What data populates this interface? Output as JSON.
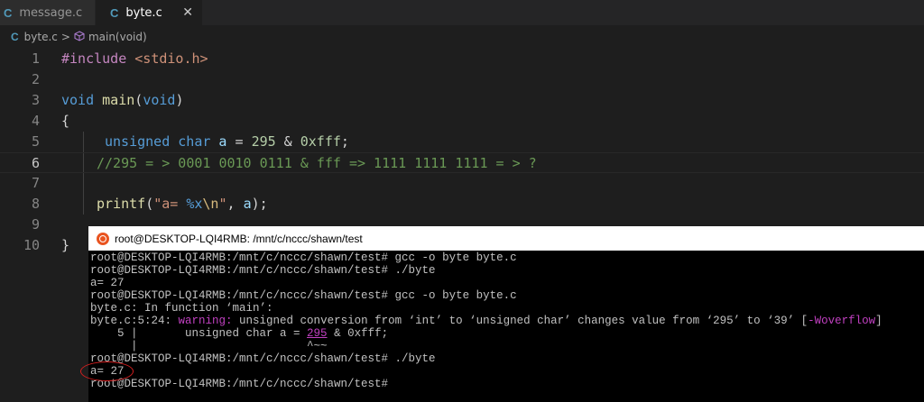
{
  "tabs": [
    {
      "icon": "C",
      "label": "message.c",
      "active": false
    },
    {
      "icon": "C",
      "label": "byte.c",
      "active": true,
      "close": "✕"
    }
  ],
  "breadcrumb": {
    "file": "byte.c",
    "separator": ">",
    "symbol": "main(void)"
  },
  "editor": {
    "line_numbers": [
      "1",
      "2",
      "3",
      "4",
      "5",
      "6",
      "7",
      "8",
      "9",
      "10"
    ],
    "current_line": 6,
    "code": {
      "l1_pp": "#include",
      "l1_hdr": " <stdio.h>",
      "l3_kw1": "void",
      "l3_fn": " main",
      "l3_p1": "(",
      "l3_kw2": "void",
      "l3_p2": ")",
      "l4": "{",
      "l5_kw": "unsigned char",
      "l5_var": " a",
      "l5_op": " = ",
      "l5_num1": "295",
      "l5_op2": " & ",
      "l5_num2": "0xfff",
      "l5_end": ";",
      "l6_comment": "//295 = > 0001 0010 0111 & fff => 1111 1111 1111 = > ?",
      "l8_fn": "printf",
      "l8_p1": "(",
      "l8_str1": "\"a= ",
      "l8_esc1": "%x",
      "l8_esc2": "\\n",
      "l8_str2": "\"",
      "l8_rest": ", ",
      "l8_var": "a",
      "l8_end": ");",
      "l10": "}"
    }
  },
  "terminal": {
    "title": "root@DESKTOP-LQI4RMB: /mnt/c/nccc/shawn/test",
    "lines": {
      "t1": "root@DESKTOP-LQI4RMB:/mnt/c/nccc/shawn/test# gcc -o byte byte.c",
      "t2": "root@DESKTOP-LQI4RMB:/mnt/c/nccc/shawn/test# ./byte",
      "t3": "a= 27",
      "t4": "root@DESKTOP-LQI4RMB:/mnt/c/nccc/shawn/test# gcc -o byte byte.c",
      "t5": "byte.c: In function ‘main’:",
      "t6_a": "byte.c:5:24: ",
      "t6_warn": "warning:",
      "t6_b": " unsigned conversion from ‘int’ to ‘unsigned char’ changes value from ‘295’ to ‘39’ [",
      "t6_flag": "-Woverflow",
      "t6_c": "]",
      "t7_a": "    5 |       unsigned char a = ",
      "t7_num": "295",
      "t7_b": " & 0xfff;",
      "t8": "      |                         ^~~",
      "t9": "root@DESKTOP-LQI4RMB:/mnt/c/nccc/shawn/test# ./byte",
      "t10": "a= 27",
      "t11": "root@DESKTOP-LQI4RMB:/mnt/c/nccc/shawn/test#"
    }
  },
  "colors": {
    "annotation_circle": "#d31f1f",
    "ubuntu_icon": "#e95420"
  }
}
